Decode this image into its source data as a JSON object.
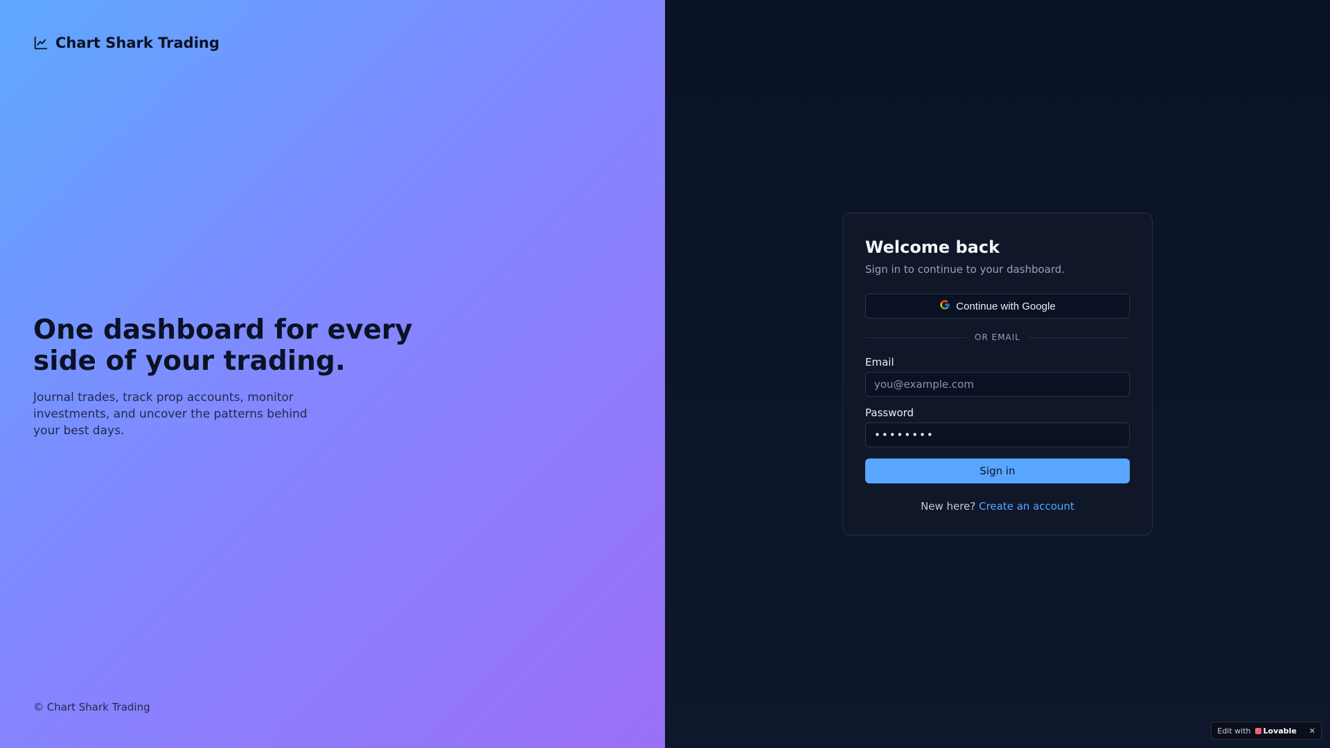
{
  "brand": {
    "name": "Chart Shark Trading",
    "icon": "line-chart-icon"
  },
  "hero": {
    "title": "One dashboard for every side of your trading.",
    "subtitle": "Journal trades, track prop accounts, monitor investments, and uncover the patterns behind your best days."
  },
  "footer": {
    "copyright": "© Chart Shark Trading"
  },
  "login": {
    "title": "Welcome back",
    "subtitle": "Sign in to continue to your dashboard.",
    "google_button": "Continue with Google",
    "divider": "OR EMAIL",
    "email_label": "Email",
    "email_placeholder": "you@example.com",
    "password_label": "Password",
    "password_value": "••••••••",
    "signin_button": "Sign in",
    "new_here": "New here?",
    "create_account": "Create an account"
  },
  "badge": {
    "prefix": "Edit with",
    "brand": "Lovable",
    "close": "✕"
  },
  "colors": {
    "accent": "#58a6ff",
    "card_bg": "#0f1729",
    "right_bg": "#0a1226"
  }
}
